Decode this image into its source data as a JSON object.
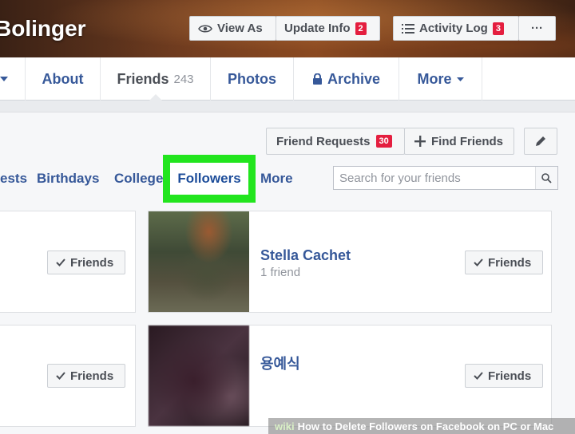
{
  "profile": {
    "name": "Bolinger"
  },
  "cover_buttons": {
    "view_as": "View As",
    "update_info": "Update Info",
    "update_info_badge": "2",
    "activity_log": "Activity Log",
    "activity_log_badge": "3",
    "more": "···"
  },
  "nav": {
    "about": "About",
    "friends": "Friends",
    "friends_count": "243",
    "photos": "Photos",
    "archive": "Archive",
    "more": "More"
  },
  "friends_panel": {
    "friend_requests": "Friend Requests",
    "friend_requests_badge": "30",
    "find_friends": "Find Friends",
    "tabs": {
      "requests": "ests",
      "birthdays": "Birthdays",
      "college": "College",
      "followers": "Followers",
      "more": "More"
    },
    "search_placeholder": "Search for your friends"
  },
  "people": [
    {
      "name": "Stella Cachet",
      "subtitle": "1 friend",
      "button": "Friends"
    },
    {
      "name": "용예식",
      "subtitle": "",
      "button": "Friends"
    }
  ],
  "left_buttons": [
    "Friends",
    "Friends"
  ],
  "watermark": {
    "brand": "wiki",
    "text": "How to Delete Followers on Facebook on PC or Mac"
  },
  "colors": {
    "accent_link": "#365899",
    "highlight": "#22e51e",
    "badge": "#e41e3f"
  }
}
